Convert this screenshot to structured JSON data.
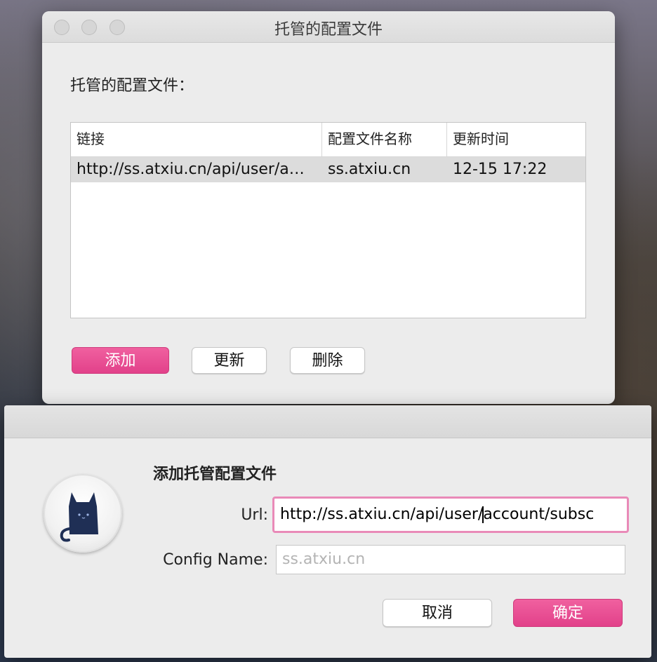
{
  "managed_window": {
    "title": "托管的配置文件",
    "section_label": "托管的配置文件：",
    "table": {
      "columns": [
        "链接",
        "配置文件名称",
        "更新时间"
      ],
      "rows": [
        {
          "url": "http://ss.atxiu.cn/api/user/a…",
          "name": "ss.atxiu.cn",
          "updated": "12-15 17:22"
        }
      ]
    },
    "buttons": {
      "add": "添加",
      "update": "更新",
      "delete": "删除"
    }
  },
  "add_dialog": {
    "title": "添加托管配置文件",
    "url_label": "Url:",
    "url_value_before_caret": "http://ss.atxiu.cn/api/user/",
    "url_value_after_caret": "account/subsc",
    "config_name_label": "Config Name:",
    "config_name_placeholder": "ss.atxiu.cn",
    "buttons": {
      "cancel": "取消",
      "ok": "确定"
    }
  },
  "colors": {
    "accent": "#e2418a",
    "focus_ring": "#e98ab8"
  },
  "icons": {
    "app_icon": "cat-icon"
  }
}
